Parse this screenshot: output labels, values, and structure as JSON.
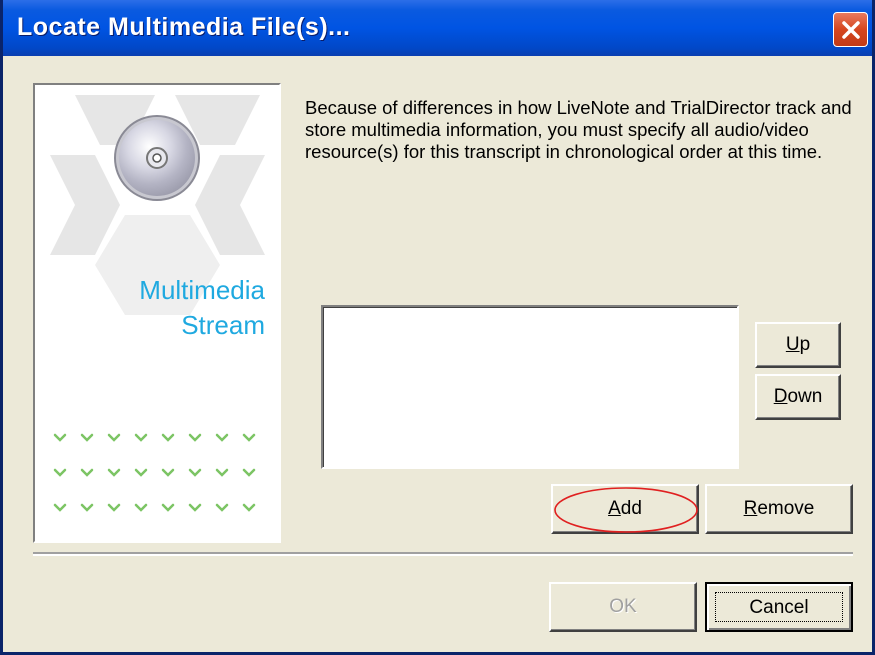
{
  "window": {
    "title": "Locate Multimedia File(s)..."
  },
  "banner": {
    "icon": "cd-disc-icon",
    "title_line1": "Multimedia",
    "title_line2": "Stream",
    "accent_color": "#1fa9e0",
    "dot_color": "#7cc464"
  },
  "description": "Because of differences in how LiveNote and TrialDirector track and store multimedia information, you must specify all audio/video resource(s) for this transcript in chronological order at this time.",
  "list": {
    "items": []
  },
  "buttons": {
    "up": {
      "key": "U",
      "rest": "p"
    },
    "down": {
      "key": "D",
      "rest": "own"
    },
    "add": {
      "key": "A",
      "rest": "dd"
    },
    "remove": {
      "key": "R",
      "rest": "emove"
    },
    "ok": "OK",
    "cancel": "Cancel"
  },
  "annotation_color": "#e02020"
}
